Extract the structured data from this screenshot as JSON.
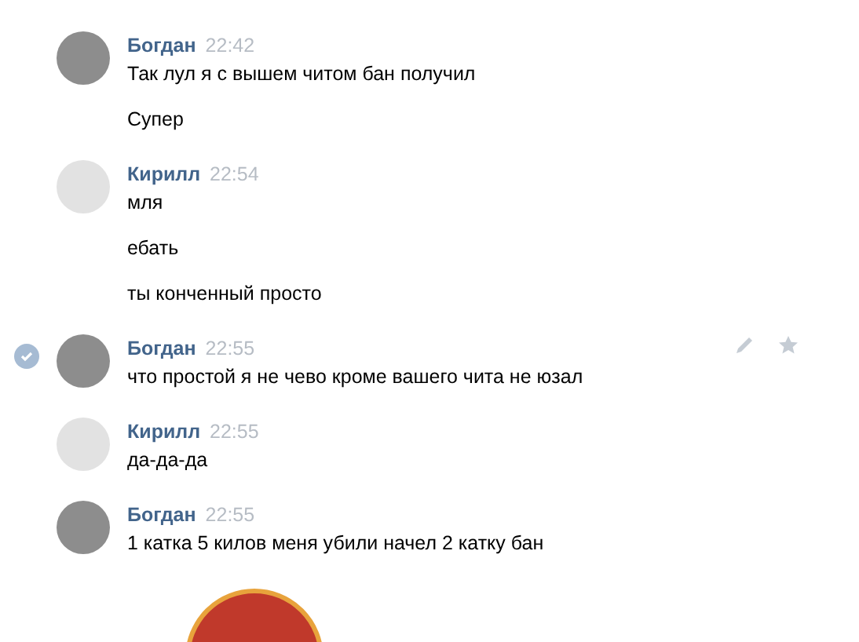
{
  "messages": [
    {
      "author": "Богдан",
      "time": "22:42",
      "selected": false,
      "items": [
        {
          "kind": "text",
          "text": "Так лул я с вышем читом бан получил"
        },
        {
          "kind": "text",
          "text": "Супер"
        }
      ]
    },
    {
      "author": "Кирилл",
      "time": "22:54",
      "selected": false,
      "items": [
        {
          "kind": "text",
          "text": "мля"
        },
        {
          "kind": "text",
          "text": "ебать"
        },
        {
          "kind": "text",
          "text": "ты конченный просто"
        }
      ]
    },
    {
      "author": "Богдан",
      "time": "22:55",
      "selected": true,
      "items": [
        {
          "kind": "text",
          "text": "что простой я не чево кроме вашего чита не юзал"
        }
      ]
    },
    {
      "author": "Кирилл",
      "time": "22:55",
      "selected": false,
      "items": [
        {
          "kind": "text",
          "text": "да-да-да"
        }
      ]
    },
    {
      "author": "Богдан",
      "time": "22:55",
      "selected": false,
      "items": [
        {
          "kind": "text",
          "text": "1 катка 5 килов меня убили начел 2 катку бан"
        },
        {
          "kind": "sticker"
        }
      ]
    }
  ]
}
